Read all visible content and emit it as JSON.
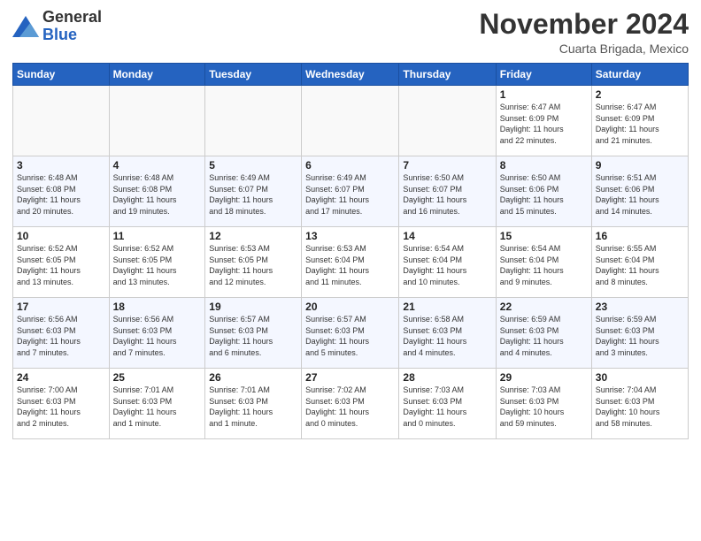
{
  "header": {
    "logo_general": "General",
    "logo_blue": "Blue",
    "month": "November 2024",
    "location": "Cuarta Brigada, Mexico"
  },
  "weekdays": [
    "Sunday",
    "Monday",
    "Tuesday",
    "Wednesday",
    "Thursday",
    "Friday",
    "Saturday"
  ],
  "weeks": [
    [
      {
        "day": "",
        "info": ""
      },
      {
        "day": "",
        "info": ""
      },
      {
        "day": "",
        "info": ""
      },
      {
        "day": "",
        "info": ""
      },
      {
        "day": "",
        "info": ""
      },
      {
        "day": "1",
        "info": "Sunrise: 6:47 AM\nSunset: 6:09 PM\nDaylight: 11 hours\nand 22 minutes."
      },
      {
        "day": "2",
        "info": "Sunrise: 6:47 AM\nSunset: 6:09 PM\nDaylight: 11 hours\nand 21 minutes."
      }
    ],
    [
      {
        "day": "3",
        "info": "Sunrise: 6:48 AM\nSunset: 6:08 PM\nDaylight: 11 hours\nand 20 minutes."
      },
      {
        "day": "4",
        "info": "Sunrise: 6:48 AM\nSunset: 6:08 PM\nDaylight: 11 hours\nand 19 minutes."
      },
      {
        "day": "5",
        "info": "Sunrise: 6:49 AM\nSunset: 6:07 PM\nDaylight: 11 hours\nand 18 minutes."
      },
      {
        "day": "6",
        "info": "Sunrise: 6:49 AM\nSunset: 6:07 PM\nDaylight: 11 hours\nand 17 minutes."
      },
      {
        "day": "7",
        "info": "Sunrise: 6:50 AM\nSunset: 6:07 PM\nDaylight: 11 hours\nand 16 minutes."
      },
      {
        "day": "8",
        "info": "Sunrise: 6:50 AM\nSunset: 6:06 PM\nDaylight: 11 hours\nand 15 minutes."
      },
      {
        "day": "9",
        "info": "Sunrise: 6:51 AM\nSunset: 6:06 PM\nDaylight: 11 hours\nand 14 minutes."
      }
    ],
    [
      {
        "day": "10",
        "info": "Sunrise: 6:52 AM\nSunset: 6:05 PM\nDaylight: 11 hours\nand 13 minutes."
      },
      {
        "day": "11",
        "info": "Sunrise: 6:52 AM\nSunset: 6:05 PM\nDaylight: 11 hours\nand 13 minutes."
      },
      {
        "day": "12",
        "info": "Sunrise: 6:53 AM\nSunset: 6:05 PM\nDaylight: 11 hours\nand 12 minutes."
      },
      {
        "day": "13",
        "info": "Sunrise: 6:53 AM\nSunset: 6:04 PM\nDaylight: 11 hours\nand 11 minutes."
      },
      {
        "day": "14",
        "info": "Sunrise: 6:54 AM\nSunset: 6:04 PM\nDaylight: 11 hours\nand 10 minutes."
      },
      {
        "day": "15",
        "info": "Sunrise: 6:54 AM\nSunset: 6:04 PM\nDaylight: 11 hours\nand 9 minutes."
      },
      {
        "day": "16",
        "info": "Sunrise: 6:55 AM\nSunset: 6:04 PM\nDaylight: 11 hours\nand 8 minutes."
      }
    ],
    [
      {
        "day": "17",
        "info": "Sunrise: 6:56 AM\nSunset: 6:03 PM\nDaylight: 11 hours\nand 7 minutes."
      },
      {
        "day": "18",
        "info": "Sunrise: 6:56 AM\nSunset: 6:03 PM\nDaylight: 11 hours\nand 7 minutes."
      },
      {
        "day": "19",
        "info": "Sunrise: 6:57 AM\nSunset: 6:03 PM\nDaylight: 11 hours\nand 6 minutes."
      },
      {
        "day": "20",
        "info": "Sunrise: 6:57 AM\nSunset: 6:03 PM\nDaylight: 11 hours\nand 5 minutes."
      },
      {
        "day": "21",
        "info": "Sunrise: 6:58 AM\nSunset: 6:03 PM\nDaylight: 11 hours\nand 4 minutes."
      },
      {
        "day": "22",
        "info": "Sunrise: 6:59 AM\nSunset: 6:03 PM\nDaylight: 11 hours\nand 4 minutes."
      },
      {
        "day": "23",
        "info": "Sunrise: 6:59 AM\nSunset: 6:03 PM\nDaylight: 11 hours\nand 3 minutes."
      }
    ],
    [
      {
        "day": "24",
        "info": "Sunrise: 7:00 AM\nSunset: 6:03 PM\nDaylight: 11 hours\nand 2 minutes."
      },
      {
        "day": "25",
        "info": "Sunrise: 7:01 AM\nSunset: 6:03 PM\nDaylight: 11 hours\nand 1 minute."
      },
      {
        "day": "26",
        "info": "Sunrise: 7:01 AM\nSunset: 6:03 PM\nDaylight: 11 hours\nand 1 minute."
      },
      {
        "day": "27",
        "info": "Sunrise: 7:02 AM\nSunset: 6:03 PM\nDaylight: 11 hours\nand 0 minutes."
      },
      {
        "day": "28",
        "info": "Sunrise: 7:03 AM\nSunset: 6:03 PM\nDaylight: 11 hours\nand 0 minutes."
      },
      {
        "day": "29",
        "info": "Sunrise: 7:03 AM\nSunset: 6:03 PM\nDaylight: 10 hours\nand 59 minutes."
      },
      {
        "day": "30",
        "info": "Sunrise: 7:04 AM\nSunset: 6:03 PM\nDaylight: 10 hours\nand 58 minutes."
      }
    ]
  ]
}
